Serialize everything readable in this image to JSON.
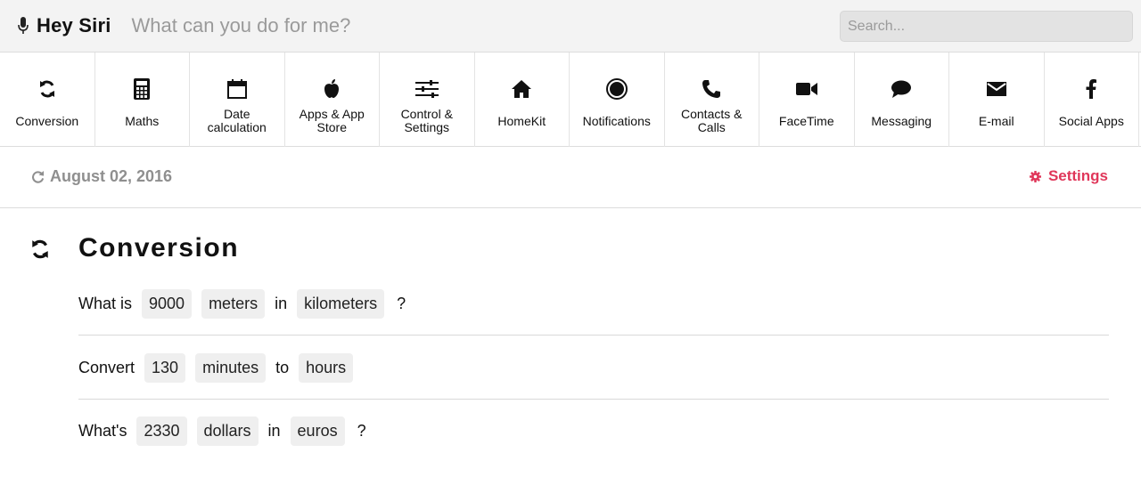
{
  "header": {
    "brand_title": "Hey Siri",
    "tagline": "What can you do for me?",
    "search_placeholder": "Search..."
  },
  "categories": [
    {
      "label": "Conversion",
      "icon": "refresh-icon"
    },
    {
      "label": "Maths",
      "icon": "calculator-icon"
    },
    {
      "label": "Date calculation",
      "icon": "calendar-icon"
    },
    {
      "label": "Apps & App Store",
      "icon": "apple-icon"
    },
    {
      "label": "Control & Settings",
      "icon": "sliders-icon"
    },
    {
      "label": "HomeKit",
      "icon": "home-icon"
    },
    {
      "label": "Notifications",
      "icon": "dot-circle-icon"
    },
    {
      "label": "Contacts & Calls",
      "icon": "phone-icon"
    },
    {
      "label": "FaceTime",
      "icon": "video-camera-icon"
    },
    {
      "label": "Messaging",
      "icon": "chat-bubble-icon"
    },
    {
      "label": "E-mail",
      "icon": "envelope-icon"
    },
    {
      "label": "Social Apps",
      "icon": "facebook-icon"
    }
  ],
  "daterow": {
    "date": "August 02, 2016",
    "settings_label": "Settings"
  },
  "section": {
    "title": "Conversion",
    "examples": [
      {
        "parts": [
          "What is",
          "9000",
          "meters",
          "in",
          "kilometers",
          "?"
        ]
      },
      {
        "parts": [
          "Convert",
          "130",
          "minutes",
          "to",
          "hours"
        ]
      },
      {
        "parts": [
          "What's",
          "2330",
          "dollars",
          "in",
          "euros",
          "?"
        ]
      }
    ]
  },
  "colors": {
    "accent": "#e0375a",
    "header_bg": "#f3f3f3",
    "muted": "#8f8f8f",
    "chip_bg": "#efefef"
  }
}
